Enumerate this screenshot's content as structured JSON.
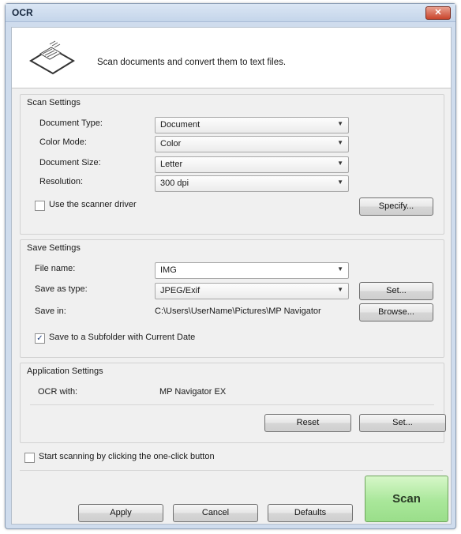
{
  "window": {
    "title": "OCR",
    "close_glyph": "✕"
  },
  "header": {
    "icon": "scanner-document-icon",
    "text": "Scan documents and convert them to text files."
  },
  "scan_settings": {
    "label": "Scan Settings",
    "document_type": {
      "label": "Document Type:",
      "value": "Document"
    },
    "color_mode": {
      "label": "Color Mode:",
      "value": "Color"
    },
    "document_size": {
      "label": "Document Size:",
      "value": "Letter"
    },
    "resolution": {
      "label": "Resolution:",
      "value": "300 dpi"
    },
    "use_driver": {
      "label": "Use the scanner driver",
      "checked": false
    },
    "specify_label": "Specify..."
  },
  "save_settings": {
    "label": "Save Settings",
    "file_name": {
      "label": "File name:",
      "value": "IMG"
    },
    "save_as_type": {
      "label": "Save as type:",
      "value": "JPEG/Exif"
    },
    "set_label": "Set...",
    "save_in": {
      "label": "Save in:",
      "value": "C:\\Users\\UserName\\Pictures\\MP Navigator"
    },
    "browse_label": "Browse...",
    "subfolder": {
      "label": "Save to a Subfolder with Current Date",
      "checked": true
    }
  },
  "app_settings": {
    "label": "Application Settings",
    "ocr_with": {
      "label": "OCR with:",
      "value": "MP Navigator EX"
    },
    "reset_label": "Reset",
    "set_label": "Set..."
  },
  "one_click": {
    "label": "Start scanning by clicking the one-click button",
    "checked": false
  },
  "footer": {
    "apply_label": "Apply",
    "cancel_label": "Cancel",
    "defaults_label": "Defaults",
    "scan_label": "Scan"
  },
  "colors": {
    "scan_button": "#a9e79a",
    "title_bar": "#c4d5ea"
  },
  "check_glyph": "✓",
  "arrow_glyph": "▼"
}
